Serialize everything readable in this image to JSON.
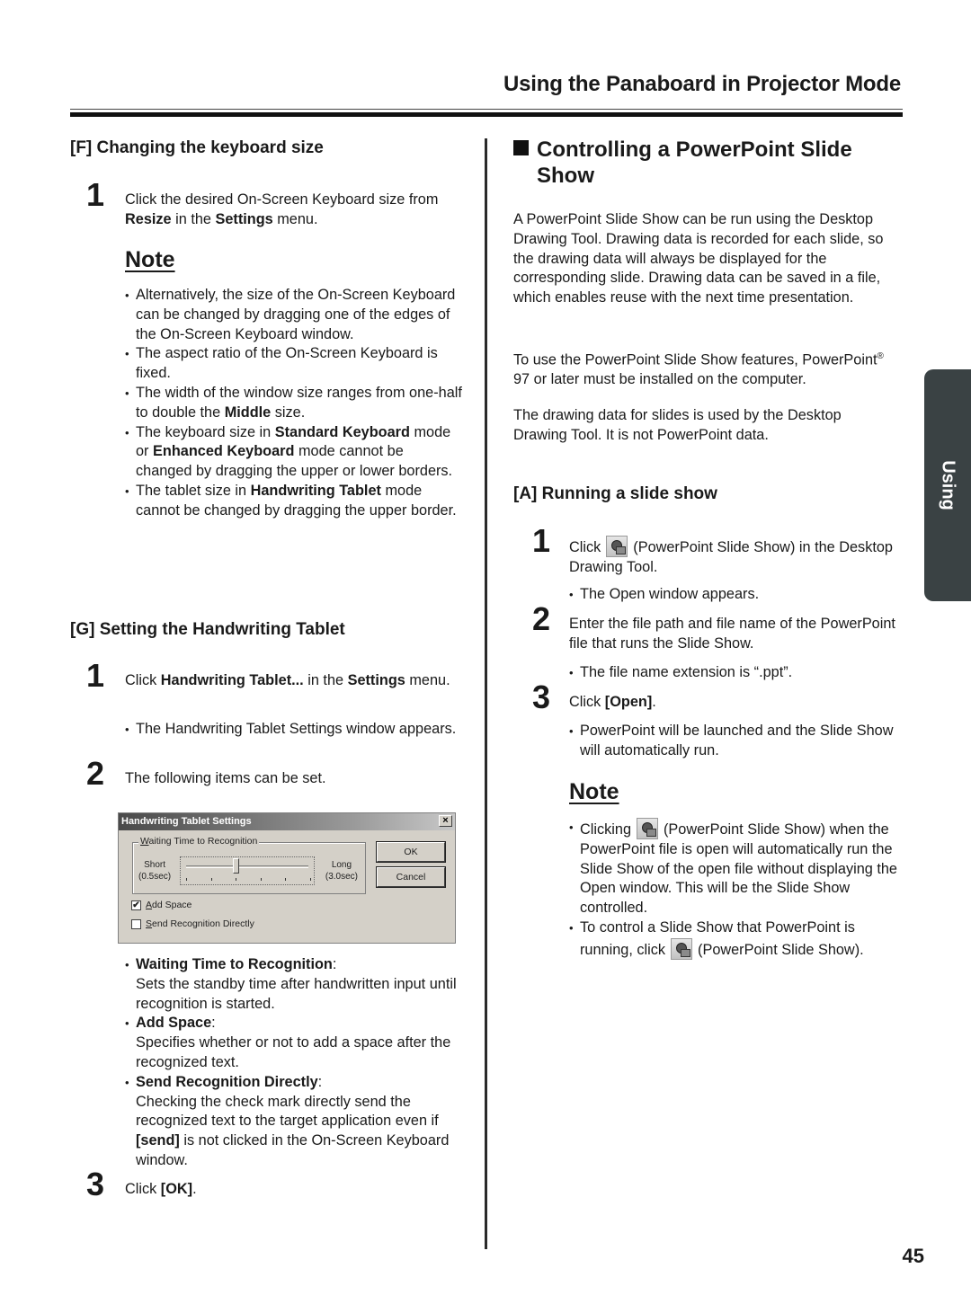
{
  "header": {
    "title": "Using the Panaboard in Projector Mode"
  },
  "side_tab": {
    "label": "Using"
  },
  "page_number": "45",
  "left": {
    "section_f": {
      "heading": "[F]  Changing the keyboard size",
      "step1": {
        "num": "1",
        "t1": "Click the desired On-Screen Keyboard size from ",
        "b1": "Resize",
        "t2": " in the ",
        "b2": "Settings",
        "t3": " menu."
      },
      "note_title": "Note",
      "notes": [
        {
          "text": "Alternatively, the size of the On-Screen Keyboard can be changed by dragging one of the edges of the On-Screen Keyboard window."
        },
        {
          "text": "The aspect ratio of the On-Screen Keyboard is fixed."
        },
        {
          "t1": "The width of the window size ranges from one-half to double the ",
          "b1": "Middle",
          "t2": " size."
        },
        {
          "t1": "The keyboard size in ",
          "b1": "Standard Keyboard",
          "t2": " mode or ",
          "b2": "Enhanced Keyboard",
          "t3": " mode cannot be changed by dragging the upper or lower borders."
        },
        {
          "t1": "The tablet size in ",
          "b1": "Handwriting Tablet",
          "t2": " mode cannot be changed by dragging the upper border."
        }
      ]
    },
    "section_g": {
      "heading": "[G] Setting the Handwriting Tablet",
      "step1": {
        "num": "1",
        "t1": "Click ",
        "b1": "Handwriting Tablet...",
        "t2": " in the ",
        "b2": "Settings",
        "t3": " menu."
      },
      "step1_bullet": "The Handwriting Tablet Settings window appears.",
      "step2": {
        "num": "2",
        "text": "The following items can be set."
      },
      "dialog": {
        "title": "Handwriting Tablet Settings",
        "close": "×",
        "group_label_u": "W",
        "group_label_rest": "aiting Time to Recognition",
        "short_label": "Short",
        "short_value": "(0.5sec)",
        "long_label": "Long",
        "long_value": "(3.0sec)",
        "slider_fraction": 0.4,
        "slider_ticks": 6,
        "ok": "OK",
        "cancel": "Cancel",
        "add_space_u": "A",
        "add_space_rest": "dd Space",
        "add_space_checked": "✔",
        "send_u": "S",
        "send_rest": "end Recognition Directly",
        "send_checked": ""
      },
      "items": [
        {
          "name": "Waiting Time to Recognition",
          "desc": "Sets the standby time after handwritten input until recognition is started."
        },
        {
          "name": "Add Space",
          "desc": "Specifies whether or not to add a space after the recognized text."
        },
        {
          "name": "Send Recognition Directly",
          "d1": "Checking the check mark directly send the recognized text to the target application even if ",
          "db": "[send]",
          "d2": " is not clicked in the On-Screen Keyboard window."
        }
      ],
      "step3": {
        "num": "3",
        "t1": "Click ",
        "b1": "[OK]",
        "t2": "."
      }
    }
  },
  "right": {
    "title_line1": "Controlling a PowerPoint Slide",
    "title_line2": "Show",
    "para1": "A PowerPoint Slide Show can be run using the Desktop Drawing Tool. Drawing data is recorded for each slide, so the drawing data will always be displayed for the corresponding slide. Drawing data can be saved in a file, which enables reuse with the next time presentation.",
    "para2_a": "To use the PowerPoint Slide Show features, PowerPoint",
    "para2_reg": "®",
    "para2_b": " 97 or later must be installed on the computer.",
    "para3": "The drawing data for slides is used by the Desktop Drawing Tool. It is not PowerPoint data.",
    "section_a": {
      "heading": "[A] Running a slide show",
      "step1": {
        "num": "1",
        "t1": "Click",
        "t2": "(PowerPoint Slide Show) in the Desktop Drawing Tool."
      },
      "step1_bullet": "The Open window appears.",
      "step2": {
        "num": "2",
        "text": "Enter the file path and file name of the PowerPoint file that runs the Slide Show."
      },
      "step2_bullet": "The file name extension is “.ppt”.",
      "step3": {
        "num": "3",
        "t1": "Click ",
        "b1": "[Open]",
        "t2": "."
      },
      "step3_bullet": "PowerPoint will be launched and the Slide Show will automatically run.",
      "note_title": "Note",
      "notes": [
        {
          "t1": "Clicking",
          "t2": "(PowerPoint Slide Show) when the PowerPoint file is open will automatically run the Slide Show of the open file without displaying the Open window. This will be the Slide Show controlled."
        },
        {
          "t1": "To control a Slide Show that PowerPoint is running, click",
          "t2": "(PowerPoint Slide Show)."
        }
      ]
    }
  }
}
